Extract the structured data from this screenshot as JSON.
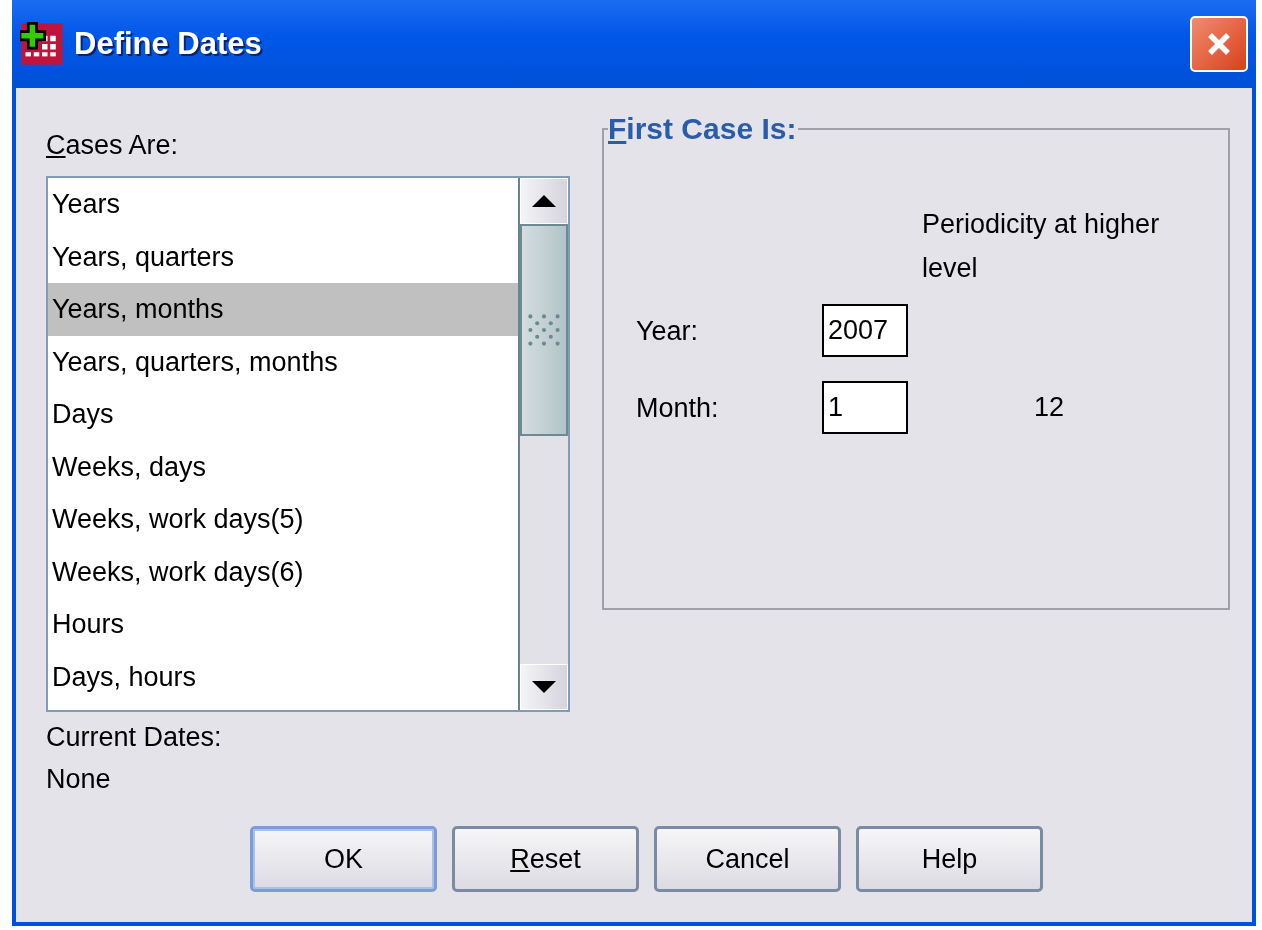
{
  "window": {
    "title": "Define Dates"
  },
  "cases_label": {
    "underlined": "C",
    "text": "ases Are:"
  },
  "cases_list": [
    {
      "label": "Years",
      "selected": false
    },
    {
      "label": "Years, quarters",
      "selected": false
    },
    {
      "label": "Years, months",
      "selected": true
    },
    {
      "label": "Years, quarters, months",
      "selected": false
    },
    {
      "label": "Days",
      "selected": false
    },
    {
      "label": "Weeks, days",
      "selected": false
    },
    {
      "label": "Weeks, work days(5)",
      "selected": false
    },
    {
      "label": "Weeks, work days(6)",
      "selected": false
    },
    {
      "label": "Hours",
      "selected": false
    },
    {
      "label": "Days, hours",
      "selected": false
    }
  ],
  "first_case": {
    "title": {
      "underlined": "F",
      "text": "irst Case Is:"
    },
    "periodicity_heading": "Periodicity at higher level",
    "fields": [
      {
        "label": "Year:",
        "value": "2007"
      },
      {
        "label": "Month:",
        "value": "1",
        "periodicity": "12"
      }
    ]
  },
  "current_dates": {
    "label": "Current Dates:",
    "value": "None"
  },
  "buttons": [
    {
      "text": "OK",
      "default": true
    },
    {
      "underlined": "R",
      "text": "eset",
      "default": false
    },
    {
      "text": "Cancel",
      "default": false
    },
    {
      "text": "Help",
      "default": false
    }
  ]
}
